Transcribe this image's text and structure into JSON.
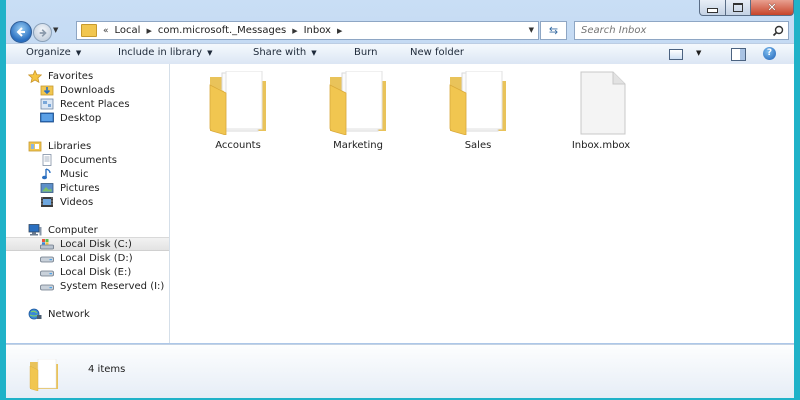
{
  "window": {
    "caption_buttons": [
      "minimize",
      "maximize",
      "close"
    ]
  },
  "address": {
    "overflow": "«",
    "crumbs": [
      "Local",
      "com.microsoft._Messages",
      "Inbox"
    ]
  },
  "search": {
    "placeholder": "Search Inbox"
  },
  "toolbar": {
    "organize": "Organize",
    "include_in_library": "Include in library",
    "share_with": "Share with",
    "burn": "Burn",
    "new_folder": "New folder"
  },
  "nav": {
    "favorites": {
      "label": "Favorites",
      "items": [
        "Downloads",
        "Recent Places",
        "Desktop"
      ]
    },
    "libraries": {
      "label": "Libraries",
      "items": [
        "Documents",
        "Music",
        "Pictures",
        "Videos"
      ]
    },
    "computer": {
      "label": "Computer",
      "items": [
        "Local Disk (C:)",
        "Local Disk (D:)",
        "Local Disk (E:)",
        "System Reserved (I:)"
      ],
      "selected": "Local Disk (C:)"
    },
    "network": {
      "label": "Network"
    }
  },
  "files": [
    {
      "name": "Accounts",
      "type": "folder"
    },
    {
      "name": "Marketing",
      "type": "folder"
    },
    {
      "name": "Sales",
      "type": "folder"
    },
    {
      "name": "Inbox.mbox",
      "type": "file"
    }
  ],
  "details": {
    "count_text": "4 items"
  },
  "colors": {
    "frame": "#20b2c8",
    "folder": "#f1c650",
    "chrome": "#c9def5"
  }
}
